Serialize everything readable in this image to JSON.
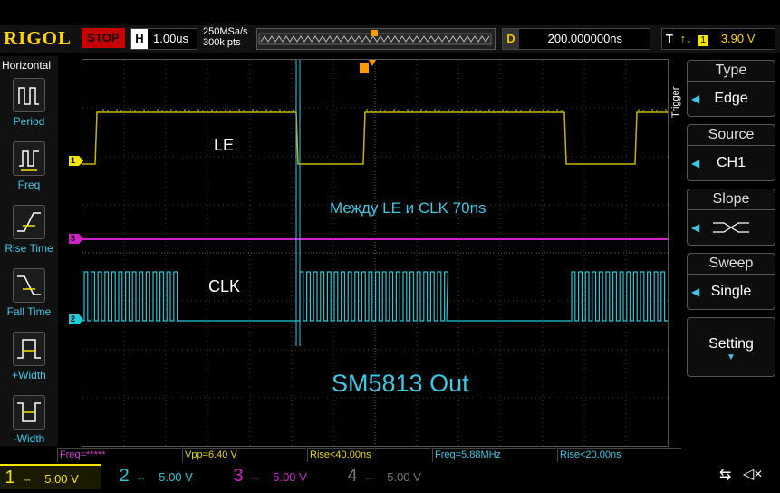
{
  "brand": {
    "logo": "RIGOL"
  },
  "topbar": {
    "run_state": "STOP",
    "timebase_label": "H",
    "timebase_value": "1.00us",
    "sample_rate": "250MSa/s",
    "memory_depth": "300k pts",
    "delay_label": "D",
    "delay_value": "200.000000ns",
    "trigger_label": "T",
    "trigger_source_num": "1",
    "trigger_level": "3.90 V"
  },
  "left_panel": {
    "title": "Horizontal",
    "items": [
      {
        "label": "Period",
        "icon": "period-icon"
      },
      {
        "label": "Freq",
        "icon": "freq-icon"
      },
      {
        "label": "Rise Time",
        "icon": "rise-time-icon"
      },
      {
        "label": "Fall Time",
        "icon": "fall-time-icon"
      },
      {
        "label": "+Width",
        "icon": "plus-width-icon"
      },
      {
        "label": "-Width",
        "icon": "minus-width-icon"
      }
    ]
  },
  "right_panel": {
    "section_label": "Trigger",
    "buttons": [
      {
        "title": "Type",
        "value": "Edge"
      },
      {
        "title": "Source",
        "value": "CH1"
      },
      {
        "title": "Slope",
        "value": ""
      },
      {
        "title": "Sweep",
        "value": "Single"
      },
      {
        "title": "Setting",
        "value": ""
      }
    ]
  },
  "annotations": {
    "le": "LE",
    "clk": "CLK",
    "between": "Между LE и CLK 70ns",
    "device": "SM5813 Out"
  },
  "channel_markers": {
    "ch1": "1",
    "ch3": "3",
    "ch2": "2"
  },
  "measurements": [
    {
      "text": "Freq=*****",
      "color": "#d040d0"
    },
    {
      "text": "Vpp=6.40 V",
      "color": "#e8d800"
    },
    {
      "text": "Rise<40.00ns",
      "color": "#e8d800"
    },
    {
      "text": "Freq=5.88MHz",
      "color": "#3cc8e8"
    },
    {
      "text": "Rise<20.00ns",
      "color": "#3cc8e8"
    }
  ],
  "channels": [
    {
      "num": "1",
      "scale": "5.00 V",
      "color": "#f5e300",
      "active": true
    },
    {
      "num": "2",
      "scale": "5.00 V",
      "color": "#20c8d8",
      "active": false
    },
    {
      "num": "3",
      "scale": "5.00 V",
      "color": "#d020c8",
      "active": false
    },
    {
      "num": "4",
      "scale": "5.00 V",
      "color": "#777777",
      "active": false
    }
  ],
  "colors": {
    "ch1": "#c8b400",
    "ch2": "#20c8d8",
    "ch3": "#d020c8",
    "cursor": "#3cc8e8",
    "trigger_marker": "#ff9900"
  }
}
